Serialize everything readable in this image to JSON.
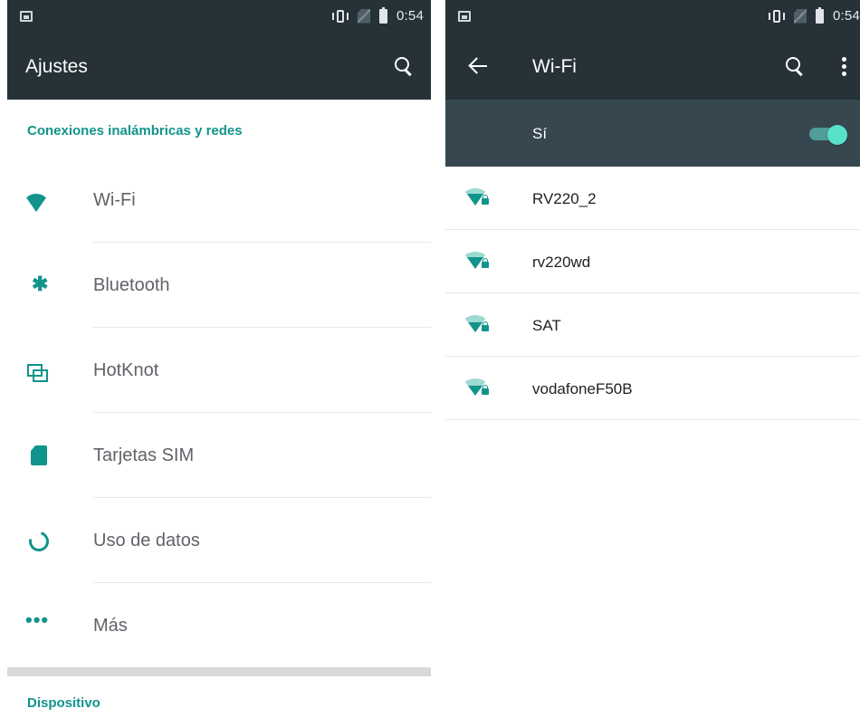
{
  "settings_screen": {
    "status_time": "0:54",
    "title": "Ajustes",
    "section_wireless": "Conexiones inalámbricas y redes",
    "items": [
      {
        "label": "Wi-Fi"
      },
      {
        "label": "Bluetooth"
      },
      {
        "label": "HotKnot"
      },
      {
        "label": "Tarjetas SIM"
      },
      {
        "label": "Uso de datos"
      },
      {
        "label": "Más"
      }
    ],
    "section_device": "Dispositivo",
    "bluetooth_glyph": "✱",
    "more_glyph": "•••"
  },
  "wifi_screen": {
    "status_time": "0:54",
    "title": "Wi-Fi",
    "enabled_label": "Sí",
    "toggle_on": true,
    "networks": [
      {
        "name": "RV220_2",
        "secured": true
      },
      {
        "name": "rv220wd",
        "secured": true
      },
      {
        "name": "SAT",
        "secured": true
      },
      {
        "name": "vodafoneF50B",
        "secured": true
      }
    ]
  },
  "colors": {
    "accent": "#11948b",
    "toolbar": "#263238",
    "subbar": "#37474f"
  },
  "icons": {
    "status_left": "image-notification-icon",
    "status_right": [
      "vibrate-icon",
      "no-sim-icon",
      "battery-charging-icon"
    ],
    "settings_toolbar": [
      "search-icon"
    ],
    "wifi_toolbar": [
      "back-arrow-icon",
      "search-icon",
      "overflow-menu-icon"
    ],
    "settings_items": [
      "wifi-icon",
      "bluetooth-icon",
      "hotknot-icon",
      "sim-card-icon",
      "data-usage-icon",
      "more-icon"
    ],
    "network": "wifi-lock-icon"
  }
}
